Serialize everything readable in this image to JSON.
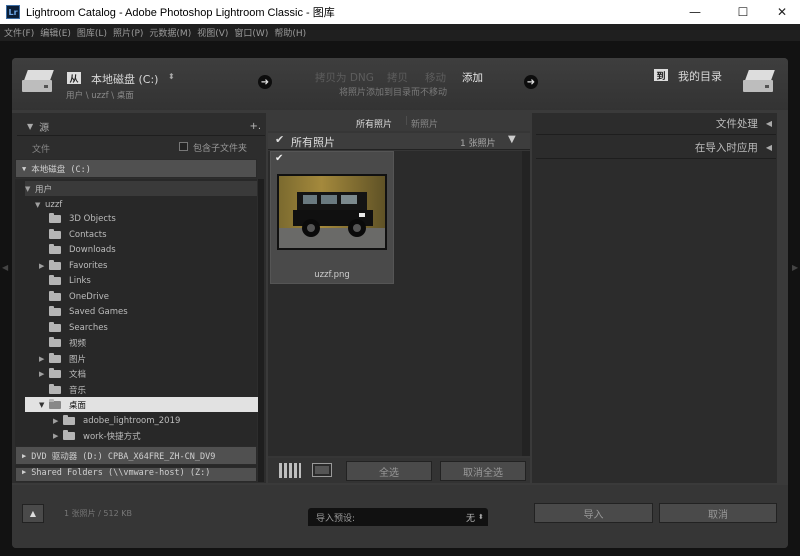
{
  "window": {
    "title": "Lightroom Catalog - Adobe Photoshop Lightroom Classic - 图库",
    "app_badge": "Lr",
    "minimize": "—",
    "maximize": "☐",
    "close": "✕"
  },
  "menu": [
    "文件(F)",
    "编辑(E)",
    "图库(L)",
    "照片(P)",
    "元数据(M)",
    "视图(V)",
    "窗口(W)",
    "帮助(H)"
  ],
  "header": {
    "from_badge": "从",
    "source_name": "本地磁盘 (C:)",
    "source_path": "用户 \\ uzzf \\ 桌面",
    "modes": [
      "拷贝为 DNG",
      "拷贝",
      "移动",
      "添加"
    ],
    "active_mode": "添加",
    "mode_hint": "将照片添加到目录而不移动",
    "dest_badge": "到",
    "dest_name": "我的目录"
  },
  "source_panel": {
    "title": "源",
    "add_symbol": "+.",
    "files_label": "文件",
    "include_sub_label": "包含子文件夹",
    "drive_c": "本地磁盘 (C:)",
    "users": "用户",
    "user": "uzzf",
    "folders": [
      "3D Objects",
      "Contacts",
      "Downloads",
      "Favorites",
      "Links",
      "OneDrive",
      "Saved Games",
      "Searches",
      "视频",
      "图片",
      "文档",
      "音乐",
      "桌面"
    ],
    "desktop_children": [
      "adobe_lightroom_2019",
      "work-快捷方式"
    ],
    "drive_d": "DVD 驱动器 (D:) CPBA_X64FRE_ZH-CN_DV9",
    "drive_next": "Shared Folders (\\\\vmware-host) (Z:)"
  },
  "grid": {
    "tabs": [
      "所有照片",
      "新照片"
    ],
    "header_title": "所有照片",
    "count": "1 张照片",
    "thumb_name": "uzzf.png",
    "check_all": "全选",
    "uncheck_all": "取消全选"
  },
  "right_panel": {
    "file_handling": "文件处理",
    "apply_on_import": "在导入时应用"
  },
  "footer": {
    "status": "1 张照片 / 512 KB",
    "preset_label": "导入预设:",
    "preset_value": "无",
    "import_btn": "导入",
    "cancel_btn": "取消"
  }
}
